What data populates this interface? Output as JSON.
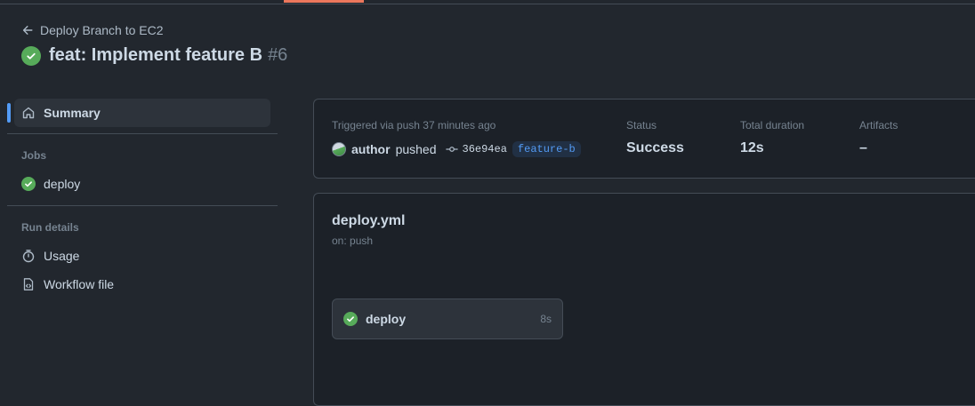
{
  "header": {
    "back_label": "Deploy Branch to EC2",
    "run_title": "feat: Implement feature B",
    "run_number": "#6",
    "status_color": "#57ab5a"
  },
  "sidebar": {
    "summary_label": "Summary",
    "jobs_heading": "Jobs",
    "jobs": [
      {
        "label": "deploy",
        "status": "success"
      }
    ],
    "run_details_heading": "Run details",
    "usage_label": "Usage",
    "workflow_file_label": "Workflow file"
  },
  "summary": {
    "trigger_text": "Triggered via push 37 minutes ago",
    "author": "author",
    "action": "pushed",
    "commit_sha": "36e94ea",
    "branch": "feature-b",
    "status_label": "Status",
    "status_value": "Success",
    "duration_label": "Total duration",
    "duration_value": "12s",
    "artifacts_label": "Artifacts",
    "artifacts_value": "–"
  },
  "workflow": {
    "file": "deploy.yml",
    "trigger": "on: push",
    "job": {
      "name": "deploy",
      "duration": "8s",
      "status": "success"
    }
  },
  "icons": {
    "back": "arrow-left-icon",
    "success": "check-circle-icon",
    "summary": "home-icon",
    "usage": "stopwatch-icon",
    "workflow_file": "file-code-icon",
    "commit": "git-commit-icon"
  },
  "colors": {
    "accent": "#539bf5",
    "active_tab": "#ec775c",
    "success": "#57ab5a"
  }
}
